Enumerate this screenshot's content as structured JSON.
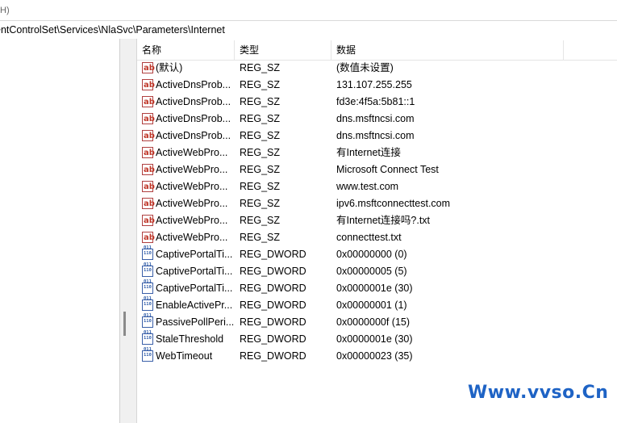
{
  "menu_fragment": "H)",
  "address": "entControlSet\\Services\\NlaSvc\\Parameters\\Internet",
  "columns": {
    "name": "名称",
    "type": "类型",
    "data": "数据"
  },
  "rows": [
    {
      "icon": "string-value-icon",
      "name": "(默认)",
      "type": "REG_SZ",
      "data": "(数值未设置)"
    },
    {
      "icon": "string-value-icon",
      "name": "ActiveDnsProb...",
      "type": "REG_SZ",
      "data": "131.107.255.255"
    },
    {
      "icon": "string-value-icon",
      "name": "ActiveDnsProb...",
      "type": "REG_SZ",
      "data": "fd3e:4f5a:5b81::1"
    },
    {
      "icon": "string-value-icon",
      "name": "ActiveDnsProb...",
      "type": "REG_SZ",
      "data": "dns.msftncsi.com"
    },
    {
      "icon": "string-value-icon",
      "name": "ActiveDnsProb...",
      "type": "REG_SZ",
      "data": "dns.msftncsi.com"
    },
    {
      "icon": "string-value-icon",
      "name": "ActiveWebPro...",
      "type": "REG_SZ",
      "data": "有Internet连接"
    },
    {
      "icon": "string-value-icon",
      "name": "ActiveWebPro...",
      "type": "REG_SZ",
      "data": "Microsoft Connect Test"
    },
    {
      "icon": "string-value-icon",
      "name": "ActiveWebPro...",
      "type": "REG_SZ",
      "data": "www.test.com"
    },
    {
      "icon": "string-value-icon",
      "name": "ActiveWebPro...",
      "type": "REG_SZ",
      "data": "ipv6.msftconnecttest.com"
    },
    {
      "icon": "string-value-icon",
      "name": "ActiveWebPro...",
      "type": "REG_SZ",
      "data": "有Internet连接吗?.txt"
    },
    {
      "icon": "string-value-icon",
      "name": "ActiveWebPro...",
      "type": "REG_SZ",
      "data": "connecttest.txt"
    },
    {
      "icon": "binary-value-icon",
      "name": "CaptivePortalTi...",
      "type": "REG_DWORD",
      "data": "0x00000000 (0)"
    },
    {
      "icon": "binary-value-icon",
      "name": "CaptivePortalTi...",
      "type": "REG_DWORD",
      "data": "0x00000005 (5)"
    },
    {
      "icon": "binary-value-icon",
      "name": "CaptivePortalTi...",
      "type": "REG_DWORD",
      "data": "0x0000001e (30)"
    },
    {
      "icon": "binary-value-icon",
      "name": "EnableActivePr...",
      "type": "REG_DWORD",
      "data": "0x00000001 (1)"
    },
    {
      "icon": "binary-value-icon",
      "name": "PassivePollPeri...",
      "type": "REG_DWORD",
      "data": "0x0000000f (15)"
    },
    {
      "icon": "binary-value-icon",
      "name": "StaleThreshold",
      "type": "REG_DWORD",
      "data": "0x0000001e (30)"
    },
    {
      "icon": "binary-value-icon",
      "name": "WebTimeout",
      "type": "REG_DWORD",
      "data": "0x00000023 (35)"
    }
  ],
  "watermark": "Www.vvso.Cn"
}
